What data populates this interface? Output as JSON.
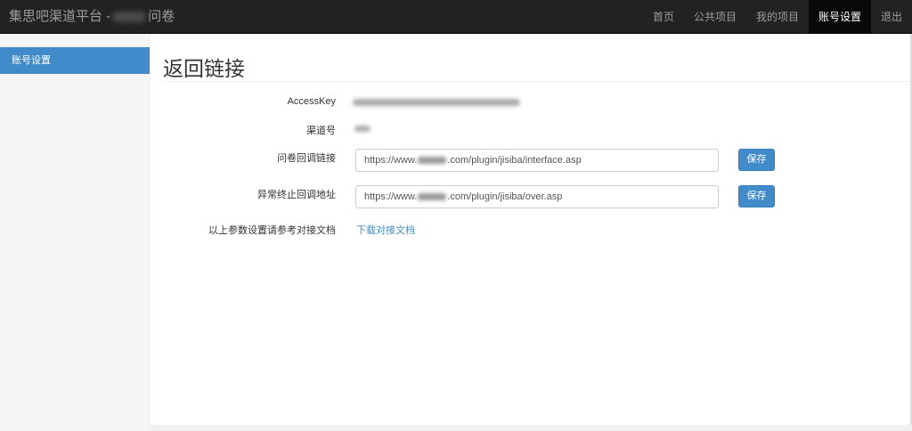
{
  "navbar": {
    "brand_prefix": "集思吧渠道平台 -",
    "brand_suffix": "问卷",
    "items": [
      {
        "label": "首页"
      },
      {
        "label": "公共项目"
      },
      {
        "label": "我的项目"
      },
      {
        "label": "账号设置",
        "active": true
      },
      {
        "label": "退出"
      }
    ]
  },
  "sidebar": {
    "items": [
      {
        "label": "账号设置",
        "active": true
      }
    ]
  },
  "main": {
    "title": "返回链接",
    "fields": {
      "access_key_label": "AccessKey",
      "channel_label": "渠道号",
      "callback_label": "问卷回调链接",
      "callback_prefix": "https://www.",
      "callback_suffix": ".com/plugin/jisiba/interface.asp",
      "abnormal_label": "异常终止回调地址",
      "abnormal_prefix": "https://www.",
      "abnormal_suffix": ".com/plugin/jisiba/over.asp",
      "save_label": "保存",
      "doc_note_label": "以上参数设置请参考对接文档",
      "doc_link_label": "下载对接文档"
    }
  },
  "colors": {
    "navbar_bg": "#222222",
    "accent": "#428bca",
    "link": "#428bca"
  }
}
